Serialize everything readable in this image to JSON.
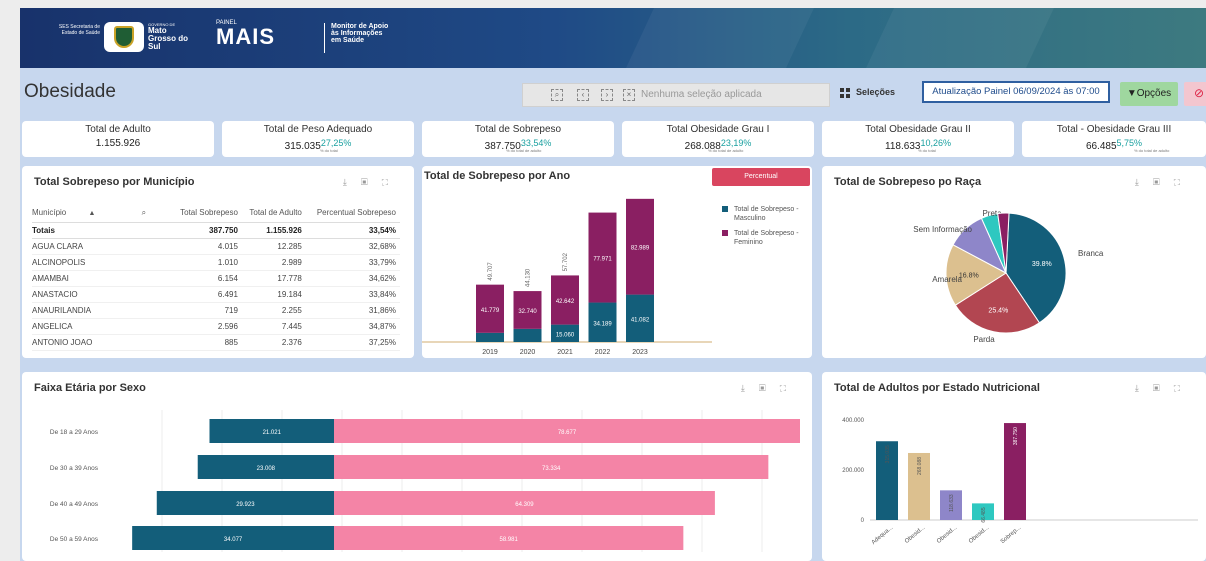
{
  "header": {
    "ses_text": "SES Secretaria de Estado de Saúde",
    "state_small": "GOVERNO DE",
    "state_name": "Mato Grosso do Sul",
    "painel_label": "PAINEL",
    "brand": "MAIS",
    "monitor_text": "Monitor de Apoio às Informações em Saúde"
  },
  "toolbar": {
    "page_title": "Obesidade",
    "selection_placeholder": "Nenhuma seleção aplicada",
    "selecoes_label": "Seleções",
    "update_label": "Atualização Painel 06/09/2024 às 07:00",
    "options_label": "Opções",
    "stop_icon": "⊘"
  },
  "kpis": [
    {
      "title": "Total de Adulto",
      "value": "1.155.926",
      "pct": "",
      "sub": ""
    },
    {
      "title": "Total de Peso Adequado",
      "value": "315.035",
      "pct": "27,25%",
      "sub": "% do total"
    },
    {
      "title": "Total de Sobrepeso",
      "value": "387.750",
      "pct": "33,54%",
      "sub": "% do total de adulto"
    },
    {
      "title": "Total Obesidade Grau I",
      "value": "268.088",
      "pct": "23,19%",
      "sub": "% do total de adulto"
    },
    {
      "title": "Total Obesidade Grau II",
      "value": "118.633",
      "pct": "10,26%",
      "sub": "% do total"
    },
    {
      "title": "Total - Obesidade Grau III",
      "value": "66.485",
      "pct": "5,75%",
      "sub": "% do total de adulto"
    }
  ],
  "municipio_panel": {
    "title": "Total Sobrepeso por Município",
    "columns": [
      "Município",
      "Total Sobrepeso",
      "Total de Adulto",
      "Percentual Sobrepeso"
    ],
    "totals": [
      "Totais",
      "387.750",
      "1.155.926",
      "33,54%"
    ],
    "rows": [
      [
        "AGUA CLARA",
        "4.015",
        "12.285",
        "32,68%"
      ],
      [
        "ALCINOPOLIS",
        "1.010",
        "2.989",
        "33,79%"
      ],
      [
        "AMAMBAI",
        "6.154",
        "17.778",
        "34,62%"
      ],
      [
        "ANASTACIO",
        "6.491",
        "19.184",
        "33,84%"
      ],
      [
        "ANAURILANDIA",
        "719",
        "2.255",
        "31,86%"
      ],
      [
        "ANGELICA",
        "2.596",
        "7.445",
        "34,87%"
      ],
      [
        "ANTONIO JOAO",
        "885",
        "2.376",
        "37,25%"
      ]
    ]
  },
  "ano_panel": {
    "title": "Total de Sobrepeso por Ano",
    "button": "Percentual"
  },
  "raca_panel": {
    "title": "Total de Sobrepeso po Raça"
  },
  "faixa_panel": {
    "title": "Faixa Etária por Sexo"
  },
  "nutri_panel": {
    "title": "Total de Adultos por Estado Nutricional"
  },
  "chart_data": [
    {
      "type": "bar",
      "title": "Total de Sobrepeso por Ano",
      "stacked": true,
      "categories": [
        "2019",
        "2020",
        "2021",
        "2022",
        "2023"
      ],
      "series": [
        {
          "name": "Total de Sobrepeso - Masculino",
          "color": "#135e7a",
          "values": [
            7926,
            11388,
            15060,
            34189,
            41082
          ]
        },
        {
          "name": "Total de Sobrepeso - Feminino",
          "color": "#8a1f62",
          "values": [
            41779,
            32740,
            42642,
            77971,
            82989
          ]
        }
      ],
      "totals": [
        "49.707",
        "44.130",
        "57.702",
        "",
        ""
      ],
      "labels_masc": [
        "",
        "",
        "15.060",
        "34.189",
        "41.082"
      ],
      "labels_fem": [
        "41.779",
        "32.740",
        "42.642",
        "77.971",
        "82.989"
      ],
      "ylim": [
        0,
        130000
      ]
    },
    {
      "type": "pie",
      "title": "Total de Sobrepeso po Raça",
      "slices": [
        {
          "name": "Branca",
          "value": 39.8,
          "color": "#135e7a",
          "label": "39.8%"
        },
        {
          "name": "Parda",
          "value": 25.4,
          "color": "#b24651",
          "label": "25.4%"
        },
        {
          "name": "Amarela",
          "value": 16.8,
          "color": "#dcc08f",
          "label": "16.8%"
        },
        {
          "name": "Sem Informação",
          "value": 10.5,
          "color": "#8e86c9",
          "label": ""
        },
        {
          "name": "Preta",
          "value": 4.5,
          "color": "#2ec8c0",
          "label": ""
        },
        {
          "name": "",
          "value": 3.0,
          "color": "#8a1f62",
          "label": ""
        }
      ]
    },
    {
      "type": "bar",
      "orientation": "horizontal",
      "title": "Faixa Etária por Sexo",
      "categories": [
        "De 18 a 29 Anos",
        "De 30 a 39 Anos",
        "De 40 a 49 Anos",
        "De 50 a 59 Anos"
      ],
      "series": [
        {
          "name": "Masculino",
          "color": "#135e7a",
          "values": [
            21021,
            23008,
            29923,
            34077
          ],
          "labels": [
            "21.021",
            "23.008",
            "29.923",
            "34.077"
          ]
        },
        {
          "name": "Feminino",
          "color": "#f484a6",
          "values": [
            78677,
            73334,
            64309,
            58981
          ],
          "labels": [
            "78.677",
            "73.334",
            "64.309",
            "58.981"
          ]
        }
      ]
    },
    {
      "type": "bar",
      "title": "Total de Adultos por Estado Nutricional",
      "categories": [
        "Adequa...",
        "Obesid...",
        "Obesid...",
        "Obesid...",
        "Sobrep..."
      ],
      "values": [
        315035,
        268088,
        118633,
        66485,
        387750
      ],
      "value_labels": [
        "315.035",
        "268.088",
        "118.633",
        "66.485",
        "387.750"
      ],
      "colors": [
        "#135e7a",
        "#dcc08f",
        "#8e86c9",
        "#2ec8c0",
        "#8a1f62"
      ],
      "yticks": [
        "0",
        "200.000",
        "400.000"
      ],
      "ylim": [
        0,
        400000
      ]
    }
  ]
}
